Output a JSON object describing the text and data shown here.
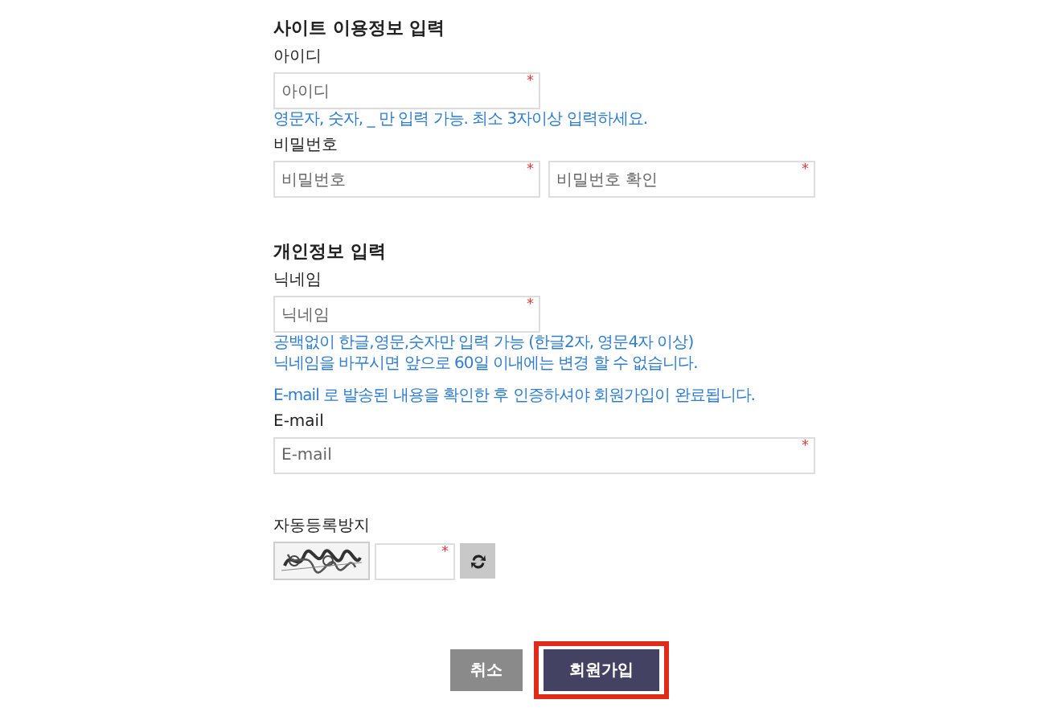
{
  "sections": [
    {
      "title": "사이트 이용정보 입력",
      "items": [
        {
          "kind": "label",
          "text": "아이디"
        },
        {
          "kind": "inputs",
          "wide": false,
          "inputs": [
            {
              "placeholder": "아이디",
              "mark": "*"
            }
          ]
        },
        {
          "kind": "hint",
          "text": "영문자, 숫자, _ 만 입력 가능. 최소 3자이상 입력하세요."
        },
        {
          "kind": "label",
          "text": "비밀번호"
        },
        {
          "kind": "inputs",
          "wide": false,
          "inputs": [
            {
              "placeholder": "비밀번호",
              "mark": "*"
            },
            {
              "placeholder": "비밀번호 확인",
              "mark": "*"
            }
          ]
        }
      ]
    },
    {
      "title": "개인정보 입력",
      "items": [
        {
          "kind": "label",
          "text": "닉네임"
        },
        {
          "kind": "inputs",
          "wide": false,
          "inputs": [
            {
              "placeholder": "닉네임",
              "mark": "*"
            }
          ]
        },
        {
          "kind": "hint",
          "text": "공백없이 한글,영문,숫자만 입력 가능 (한글2자, 영문4자 이상)"
        },
        {
          "kind": "hint",
          "text": "닉네임을 바꾸시면 앞으로 60일 이내에는 변경 할 수 없습니다."
        },
        {
          "kind": "notice",
          "text": "E-mail 로 발송된 내용을 확인한 후 인증하셔야 회원가입이 완료됩니다."
        },
        {
          "kind": "label",
          "text": "E-mail"
        },
        {
          "kind": "inputs",
          "wide": true,
          "inputs": [
            {
              "placeholder": "E-mail",
              "mark": "*"
            }
          ]
        }
      ]
    }
  ],
  "captcha": {
    "label": "자동등록방지",
    "mark": "*"
  },
  "buttons": [
    {
      "label": "취소",
      "kind": "cancel",
      "highlighted": false
    },
    {
      "label": "회원가입",
      "kind": "submit",
      "highlighted": true
    }
  ]
}
